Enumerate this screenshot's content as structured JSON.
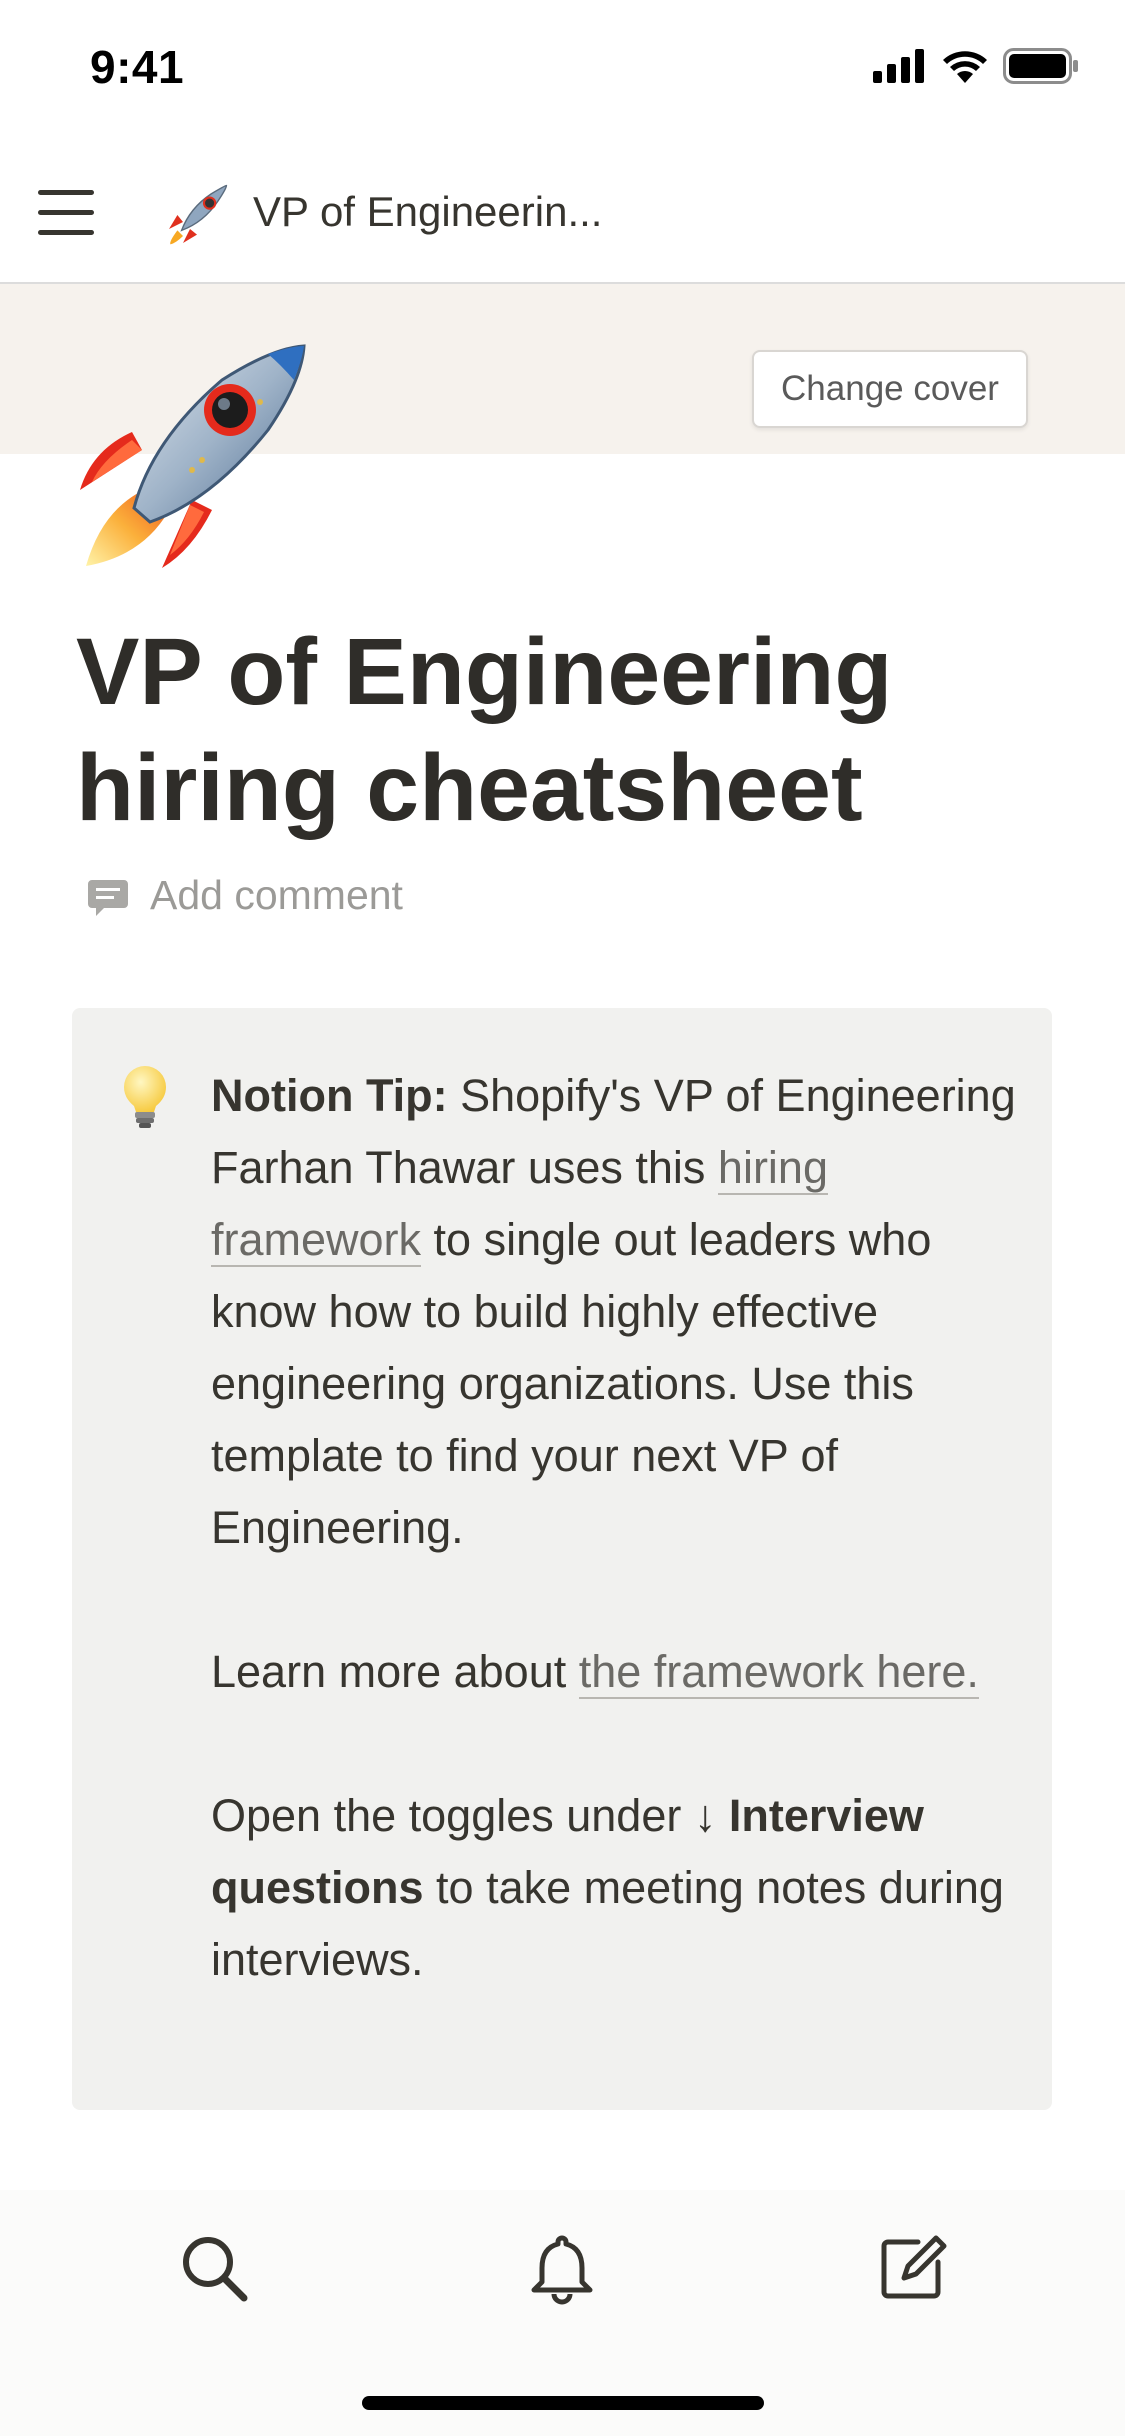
{
  "status_bar": {
    "time": "9:41",
    "icons": [
      "cellular-signal-icon",
      "wifi-icon",
      "battery-icon"
    ]
  },
  "nav": {
    "menu_icon": "hamburger-menu-icon",
    "page_icon": "rocket-icon",
    "title": "VP of Engineerin..."
  },
  "cover": {
    "color": "#f6f2ed",
    "change_cover_label": "Change cover"
  },
  "page": {
    "icon": "rocket-icon",
    "title": "VP of Engineering hiring cheatsheet",
    "add_comment_label": "Add comment"
  },
  "callout": {
    "icon": "lightbulb-icon",
    "background": "#f1f1ef",
    "tip_label": "Notion Tip:",
    "tip_text_1": " Shopify's VP of Engineering Farhan Thawar uses this ",
    "tip_link": "hiring framework",
    "tip_text_2": " to single out leaders who know how to build highly effective engineering organizations. Use this template to find your next VP of Engineering.",
    "learn_more_text": "Learn more about ",
    "learn_more_link": "the framework here.",
    "toggles_text_1": "Open the toggles under ",
    "toggles_bold": "↓ Interview questions",
    "toggles_text_2": " to take meeting notes during interviews."
  },
  "bottom_bar": {
    "icons": [
      "search-icon",
      "bell-icon",
      "compose-icon"
    ]
  }
}
